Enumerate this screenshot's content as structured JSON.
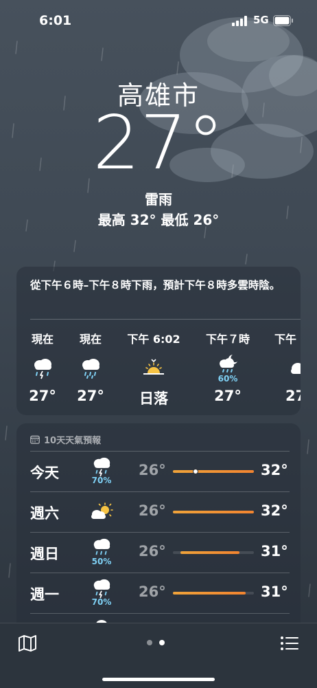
{
  "status_bar": {
    "time": "6:01",
    "network": "5G"
  },
  "location": {
    "city": "高雄市",
    "temperature": "27°",
    "condition": "雷雨",
    "high_low": "最高 32°  最低 26°"
  },
  "hourly": {
    "summary": "從下午６時–下午８時下雨，預計下午８時多雲時陰。",
    "items": [
      {
        "label": "現在",
        "icon": "thunder-rain-icon",
        "precip": "",
        "value": "27°"
      },
      {
        "label": "現在",
        "icon": "rain-icon",
        "precip": "",
        "value": "27°"
      },
      {
        "label": "下午 6:02",
        "icon": "sunset-icon",
        "precip": "",
        "value": "日落"
      },
      {
        "label": "下午７時",
        "icon": "partly-cloudy-night-rain-icon",
        "precip": "60%",
        "value": "27°"
      },
      {
        "label": "下午",
        "icon": "cloud-icon",
        "precip": "",
        "value": "27"
      }
    ]
  },
  "daily": {
    "header": "10天天氣預報",
    "days": [
      {
        "day": "今天",
        "icon": "thunder-rain-icon",
        "precip": "70%",
        "low": "26°",
        "high": "32°",
        "bar_start": 0.0,
        "bar_end": 1.0,
        "current_marker": 0.28
      },
      {
        "day": "週六",
        "icon": "partly-sunny-icon",
        "precip": "",
        "low": "26°",
        "high": "32°",
        "bar_start": 0.0,
        "bar_end": 1.0
      },
      {
        "day": "週日",
        "icon": "rain-icon",
        "precip": "50%",
        "low": "26°",
        "high": "31°",
        "bar_start": 0.09,
        "bar_end": 0.82
      },
      {
        "day": "週一",
        "icon": "thunder-rain-icon",
        "precip": "70%",
        "low": "26°",
        "high": "31°",
        "bar_start": 0.0,
        "bar_end": 0.9
      }
    ]
  },
  "colors": {
    "precip": "#7fd1f5",
    "bar_warm": "#f28430",
    "background": "#3f4954"
  }
}
